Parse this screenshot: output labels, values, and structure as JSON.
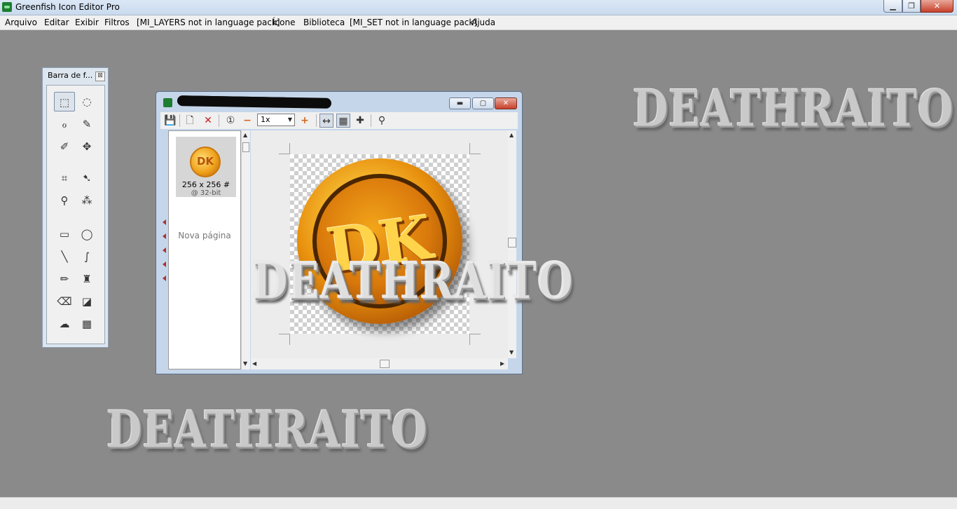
{
  "window": {
    "title": "Greenfish Icon Editor Pro",
    "controls": {
      "minimize": "▁",
      "maximize": "❐",
      "close": "✕"
    }
  },
  "menubar": {
    "items": [
      "Arquivo",
      "Editar",
      "Exibir",
      "Filtros",
      "[MI_LAYERS not in language pack]",
      "Ícone",
      "Biblioteca",
      "[MI_SET not in language pack]",
      "Ajuda"
    ]
  },
  "watermark": {
    "text": "DEATHRAITO"
  },
  "toolbox": {
    "title": "Barra de f...",
    "close": "⊠",
    "tools": [
      {
        "name": "rect-select",
        "glyph": "⬚",
        "active": true
      },
      {
        "name": "ellipse-select",
        "glyph": "◌",
        "active": false
      },
      {
        "name": "lasso",
        "glyph": "ℴ",
        "active": false
      },
      {
        "name": "magic-wand",
        "glyph": "✎",
        "active": false
      },
      {
        "name": "pencil-select",
        "glyph": "✐",
        "active": false
      },
      {
        "name": "move",
        "glyph": "✥",
        "active": false
      },
      {
        "name": "crop",
        "glyph": "⌗",
        "active": false
      },
      {
        "name": "pointer",
        "glyph": "➷",
        "active": false
      },
      {
        "name": "eyedropper",
        "glyph": "⚲",
        "active": false
      },
      {
        "name": "spray",
        "glyph": "⁂",
        "active": false
      },
      {
        "name": "rectangle",
        "glyph": "▭",
        "active": false
      },
      {
        "name": "ellipse",
        "glyph": "◯",
        "active": false
      },
      {
        "name": "line",
        "glyph": "╲",
        "active": false
      },
      {
        "name": "curve",
        "glyph": "∫",
        "active": false
      },
      {
        "name": "pencil",
        "glyph": "✏",
        "active": false
      },
      {
        "name": "brush",
        "glyph": "♜",
        "active": false
      },
      {
        "name": "eraser",
        "glyph": "⌫",
        "active": false
      },
      {
        "name": "fill",
        "glyph": "◪",
        "active": false
      },
      {
        "name": "smudge",
        "glyph": "☁",
        "active": false
      },
      {
        "name": "gradient",
        "glyph": "▦",
        "active": false
      }
    ]
  },
  "document": {
    "title": "████████████████████",
    "controls": {
      "minimize": "▬",
      "maximize": "▢",
      "close": "✕"
    },
    "toolbar": {
      "save": "💾",
      "new": "🗋",
      "delete": "✕",
      "page": "①",
      "zoom_out": "−",
      "zoom_value": "1x",
      "zoom_arrow": "▼",
      "zoom_in": "+",
      "fit": "↔",
      "grid": "▦",
      "crosshair": "✚",
      "search": "⚲"
    },
    "pages": {
      "thumbnail_label": "DK",
      "thumbnail_size": "256 x 256 #",
      "thumbnail_bits": "@ 32-bit",
      "new_page": "Nova página"
    },
    "canvas": {
      "logo_text": "DK"
    },
    "scroll": {
      "up": "▲",
      "down": "▼",
      "left": "◀",
      "right": "▶"
    }
  }
}
